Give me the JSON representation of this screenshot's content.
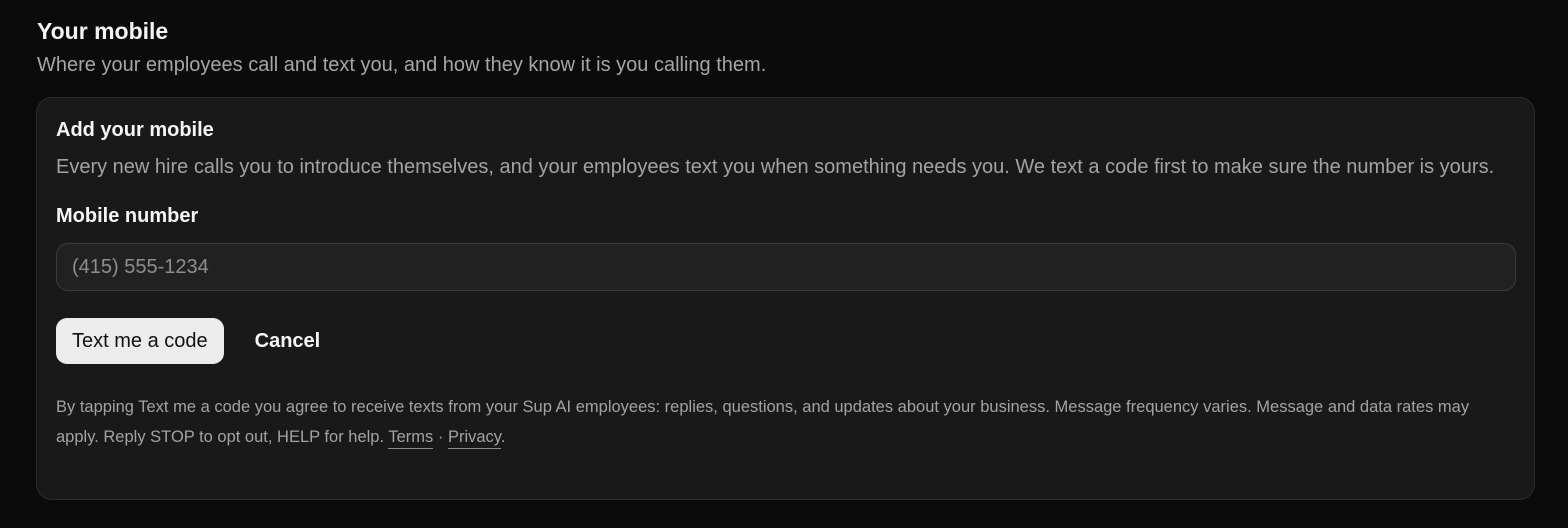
{
  "section": {
    "title": "Your mobile",
    "subtitle": "Where your employees call and text you, and how they know it is you calling them."
  },
  "card": {
    "title": "Add your mobile",
    "description": "Every new hire calls you to introduce themselves, and your employees text you when something needs you. We text a code first to make sure the number is yours.",
    "field_label": "Mobile number",
    "phone_input": {
      "value": "",
      "placeholder": "(415) 555-1234"
    },
    "primary_button": "Text me a code",
    "cancel_button": "Cancel",
    "legal": {
      "text": "By tapping Text me a code you agree to receive texts from your Sup AI employees: replies, questions, and updates about your business. Message frequency varies. Message and data rates may apply. Reply STOP to opt out, HELP for help.",
      "terms_link": "Terms",
      "separator": "·",
      "privacy_link": "Privacy",
      "end_punct": "."
    }
  },
  "colors": {
    "background": "#0b0b0b",
    "card_bg": "#191919",
    "primary_button_bg": "#ececec"
  }
}
